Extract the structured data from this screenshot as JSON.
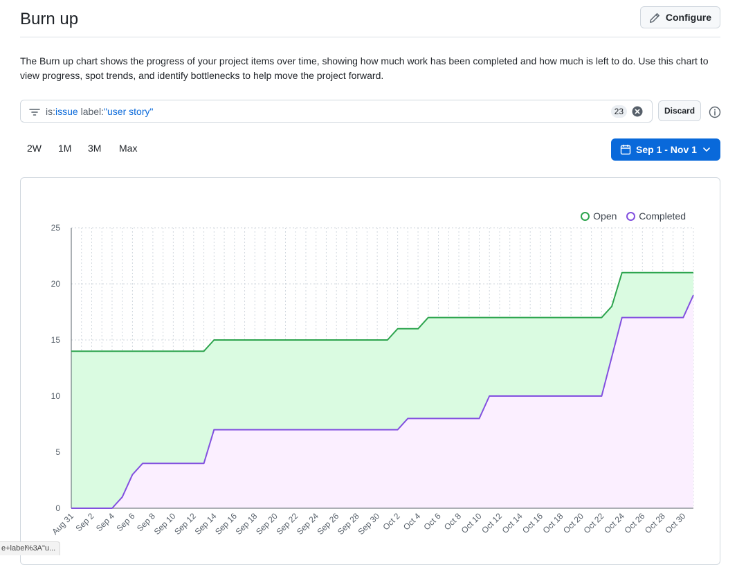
{
  "header": {
    "title": "Burn up",
    "configure_label": "Configure"
  },
  "description": "The Burn up chart shows the progress of your project items over time, showing how much work has been completed and how much is left to do. Use this chart to view progress, spot trends, and identify bottlenecks to help move the project forward.",
  "filter": {
    "query_parts": [
      {
        "text": "is:",
        "kind": "key"
      },
      {
        "text": "issue",
        "kind": "value"
      },
      {
        "text": " label:",
        "kind": "key"
      },
      {
        "text": "\"user story\"",
        "kind": "value"
      }
    ],
    "count": "23",
    "discard_label": "Discard"
  },
  "range_tabs": [
    "2W",
    "1M",
    "3M",
    "Max"
  ],
  "date_range": {
    "label": "Sep 1 - Nov 1"
  },
  "status_url": "e+label%3A\"u...",
  "colors": {
    "open_line": "#2da44e",
    "open_fill": "#dafbe1",
    "completed_line": "#8250df",
    "completed_fill": "#fbefff",
    "accent": "#0969da"
  },
  "chart_data": {
    "type": "area",
    "title": "",
    "xlabel": "",
    "ylabel": "",
    "ylim": [
      0,
      25
    ],
    "yticks": [
      0,
      5,
      10,
      15,
      20,
      25
    ],
    "xlim": [
      "Aug 31",
      "Oct 31"
    ],
    "grid": true,
    "legend_position": "top-right",
    "x_tick_labels": [
      "Aug 31",
      "Sep 2",
      "Sep 4",
      "Sep 6",
      "Sep 8",
      "Sep 10",
      "Sep 12",
      "Sep 14",
      "Sep 16",
      "Sep 18",
      "Sep 20",
      "Sep 22",
      "Sep 24",
      "Sep 26",
      "Sep 28",
      "Sep 30",
      "Oct 2",
      "Oct 4",
      "Oct 6",
      "Oct 8",
      "Oct 10",
      "Oct 12",
      "Oct 14",
      "Oct 16",
      "Oct 18",
      "Oct 20",
      "Oct 22",
      "Oct 24",
      "Oct 26",
      "Oct 28",
      "Oct 30"
    ],
    "series": [
      {
        "name": "Open",
        "color": "#2da44e",
        "points": [
          [
            "Aug 31",
            14
          ],
          [
            "Sep 13",
            14
          ],
          [
            "Sep 14",
            15
          ],
          [
            "Sep 30",
            15
          ],
          [
            "Oct 1",
            15
          ],
          [
            "Oct 2",
            16
          ],
          [
            "Oct 3",
            16
          ],
          [
            "Oct 4",
            16
          ],
          [
            "Oct 5",
            17
          ],
          [
            "Oct 22",
            17
          ],
          [
            "Oct 23",
            18
          ],
          [
            "Oct 24",
            21
          ],
          [
            "Oct 31",
            21
          ]
        ]
      },
      {
        "name": "Completed",
        "color": "#8250df",
        "points": [
          [
            "Aug 31",
            0
          ],
          [
            "Sep 2",
            0
          ],
          [
            "Sep 4",
            0
          ],
          [
            "Sep 5",
            1
          ],
          [
            "Sep 6",
            3
          ],
          [
            "Sep 7",
            4
          ],
          [
            "Sep 13",
            4
          ],
          [
            "Sep 14",
            7
          ],
          [
            "Oct 2",
            7
          ],
          [
            "Oct 3",
            8
          ],
          [
            "Oct 9",
            8
          ],
          [
            "Oct 10",
            8
          ],
          [
            "Oct 11",
            10
          ],
          [
            "Oct 22",
            10
          ],
          [
            "Oct 24",
            17
          ],
          [
            "Oct 30",
            17
          ],
          [
            "Oct 31",
            19
          ]
        ]
      }
    ]
  }
}
